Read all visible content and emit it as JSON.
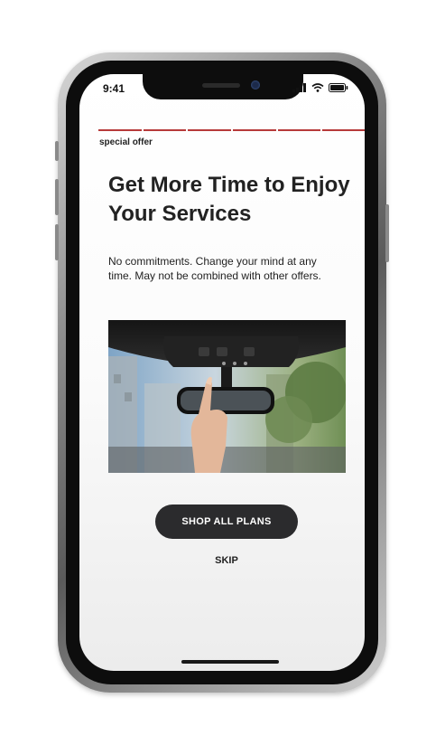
{
  "status_bar": {
    "time": "9:41",
    "icons": [
      "signal-icon",
      "wifi-icon",
      "battery-icon"
    ]
  },
  "progress": {
    "segments": 6,
    "color": "#b73a3a"
  },
  "offer": {
    "eyebrow": "special offer",
    "headline": "Get More Time to Enjoy Your Services",
    "body": "No commitments. Change your mind at any time. May not be combined with other offers."
  },
  "actions": {
    "primary_label": "SHOP ALL PLANS",
    "skip_label": "SKIP"
  },
  "colors": {
    "accent": "#b73a3a",
    "button": "#2b2b2d",
    "text": "#222222"
  }
}
